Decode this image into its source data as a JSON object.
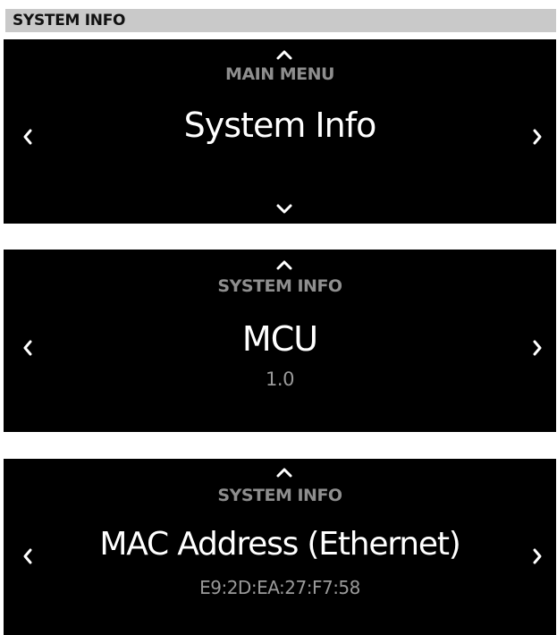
{
  "header": {
    "title": "SYSTEM INFO"
  },
  "screens": [
    {
      "menu_label": "MAIN MENU",
      "title": "System Info",
      "icons": [
        "chevron-up-icon",
        "chevron-left-icon",
        "chevron-right-icon",
        "chevron-down-icon"
      ]
    },
    {
      "menu_label": "SYSTEM INFO",
      "title": "MCU",
      "value": "1.0",
      "icons": [
        "chevron-up-icon",
        "chevron-left-icon",
        "chevron-right-icon"
      ]
    },
    {
      "menu_label": "SYSTEM INFO",
      "title": "MAC Address (Ethernet)",
      "value": "E9:2D:EA:27:F7:58",
      "icons": [
        "chevron-up-icon",
        "chevron-left-icon",
        "chevron-right-icon"
      ]
    }
  ],
  "colors": {
    "header_background": "#c9c9c9",
    "screen_background": "#000000",
    "title_text": "#ffffff",
    "label_text": "#8e8e8e",
    "value_text": "#9a9a9a"
  }
}
